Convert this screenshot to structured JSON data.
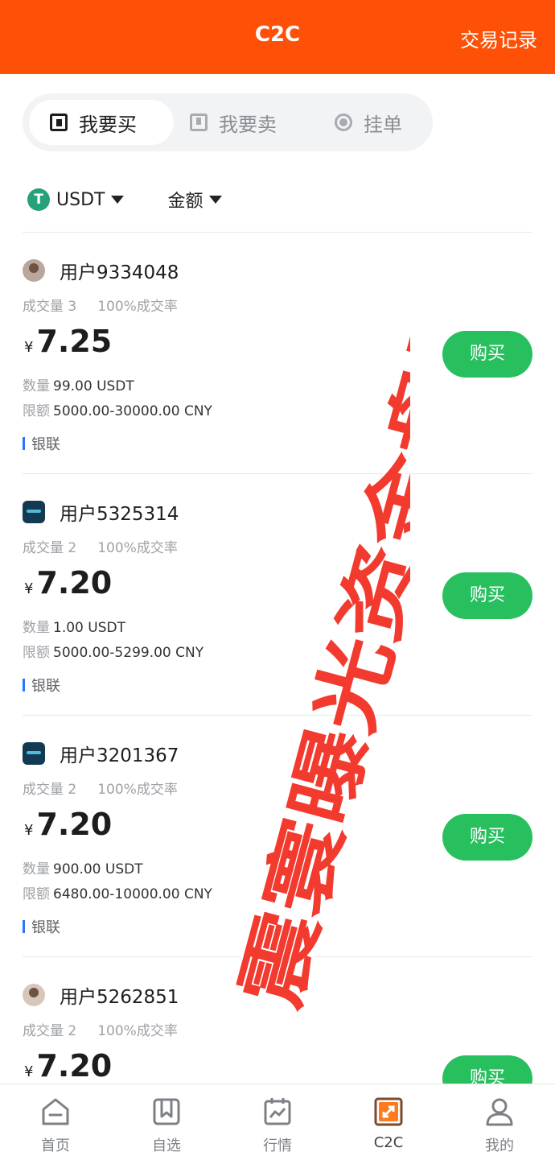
{
  "header": {
    "title": "C2C",
    "records_label": "交易记录"
  },
  "segment": {
    "buy": "我要买",
    "sell": "我要卖",
    "orders": "挂单"
  },
  "filters": {
    "coin_icon": "T",
    "coin": "USDT",
    "amount": "金额"
  },
  "labels": {
    "qty": "数量",
    "limit": "限额",
    "currency": "¥",
    "buy_button": "购买"
  },
  "offers": [
    {
      "user": "用户9334048",
      "volume": "成交量 3",
      "rate": "100%成交率",
      "price": "7.25",
      "qty": "99.00 USDT",
      "limit": "5000.00-30000.00 CNY",
      "pay": "银联",
      "avatar": "person"
    },
    {
      "user": "用户5325314",
      "volume": "成交量 2",
      "rate": "100%成交率",
      "price": "7.20",
      "qty": "1.00 USDT",
      "limit": "5000.00-5299.00 CNY",
      "pay": "银联",
      "avatar": "logo"
    },
    {
      "user": "用户3201367",
      "volume": "成交量 2",
      "rate": "100%成交率",
      "price": "7.20",
      "qty": "900.00 USDT",
      "limit": "6480.00-10000.00 CNY",
      "pay": "银联",
      "avatar": "logo"
    },
    {
      "user": "用户5262851",
      "volume": "成交量 2",
      "rate": "100%成交率",
      "price": "7.20",
      "qty": "",
      "limit": "",
      "pay": "",
      "avatar": "person"
    }
  ],
  "tabbar": {
    "home": "首页",
    "watchlist": "自选",
    "market": "行情",
    "c2c": "C2C",
    "mine": "我的"
  },
  "watermark": {
    "text": "震寰曝光资金盘骗局"
  },
  "colors": {
    "brand": "#fe5107",
    "buy": "#28c05f",
    "watermark": "#f23a2e",
    "tether": "#26a17b"
  }
}
